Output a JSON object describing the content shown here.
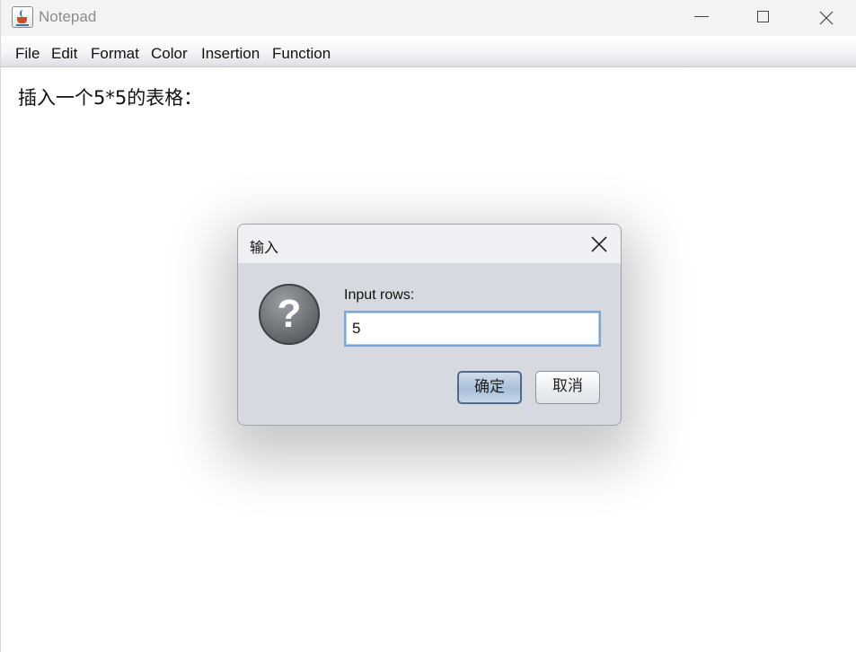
{
  "window": {
    "title": "Notepad",
    "icon": "java-cup-icon"
  },
  "menubar": {
    "items": [
      "File",
      "Edit",
      "Format",
      "Color",
      "Insertion",
      "Function"
    ]
  },
  "editor": {
    "content": "插入一个5*5的表格："
  },
  "dialog": {
    "title": "输入",
    "prompt": "Input rows:",
    "input_value": "5",
    "ok_label": "确定",
    "cancel_label": "取消",
    "icon": "question-icon"
  },
  "colors": {
    "dialog_background": "#d6d9e0",
    "dialog_titlebar": "#eef0f4",
    "input_focus_border": "#7ea4d3",
    "ok_button_border": "#54698a"
  }
}
